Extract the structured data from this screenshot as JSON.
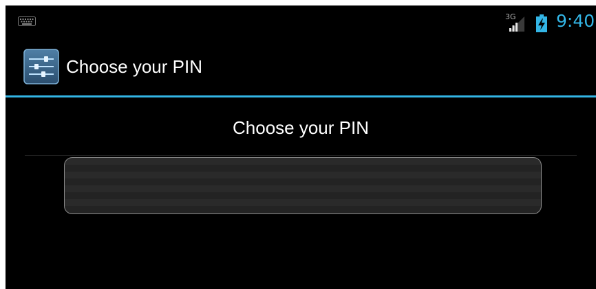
{
  "status_bar": {
    "keyboard_icon": "keyboard-icon",
    "network_type": "3G",
    "signal_icon": "signal-icon",
    "battery_icon": "battery-charging-icon",
    "time": "9:40",
    "accent_color": "#33b5e5"
  },
  "action_bar": {
    "app_icon": "settings-sliders-icon",
    "title": "Choose your PIN"
  },
  "content": {
    "prompt": "Choose your PIN",
    "pin_input": {
      "value": "",
      "placeholder": ""
    }
  },
  "colors": {
    "background": "#000000",
    "text": "#ffffff",
    "accent": "#33b5e5",
    "field_border": "#8a8a8a"
  }
}
